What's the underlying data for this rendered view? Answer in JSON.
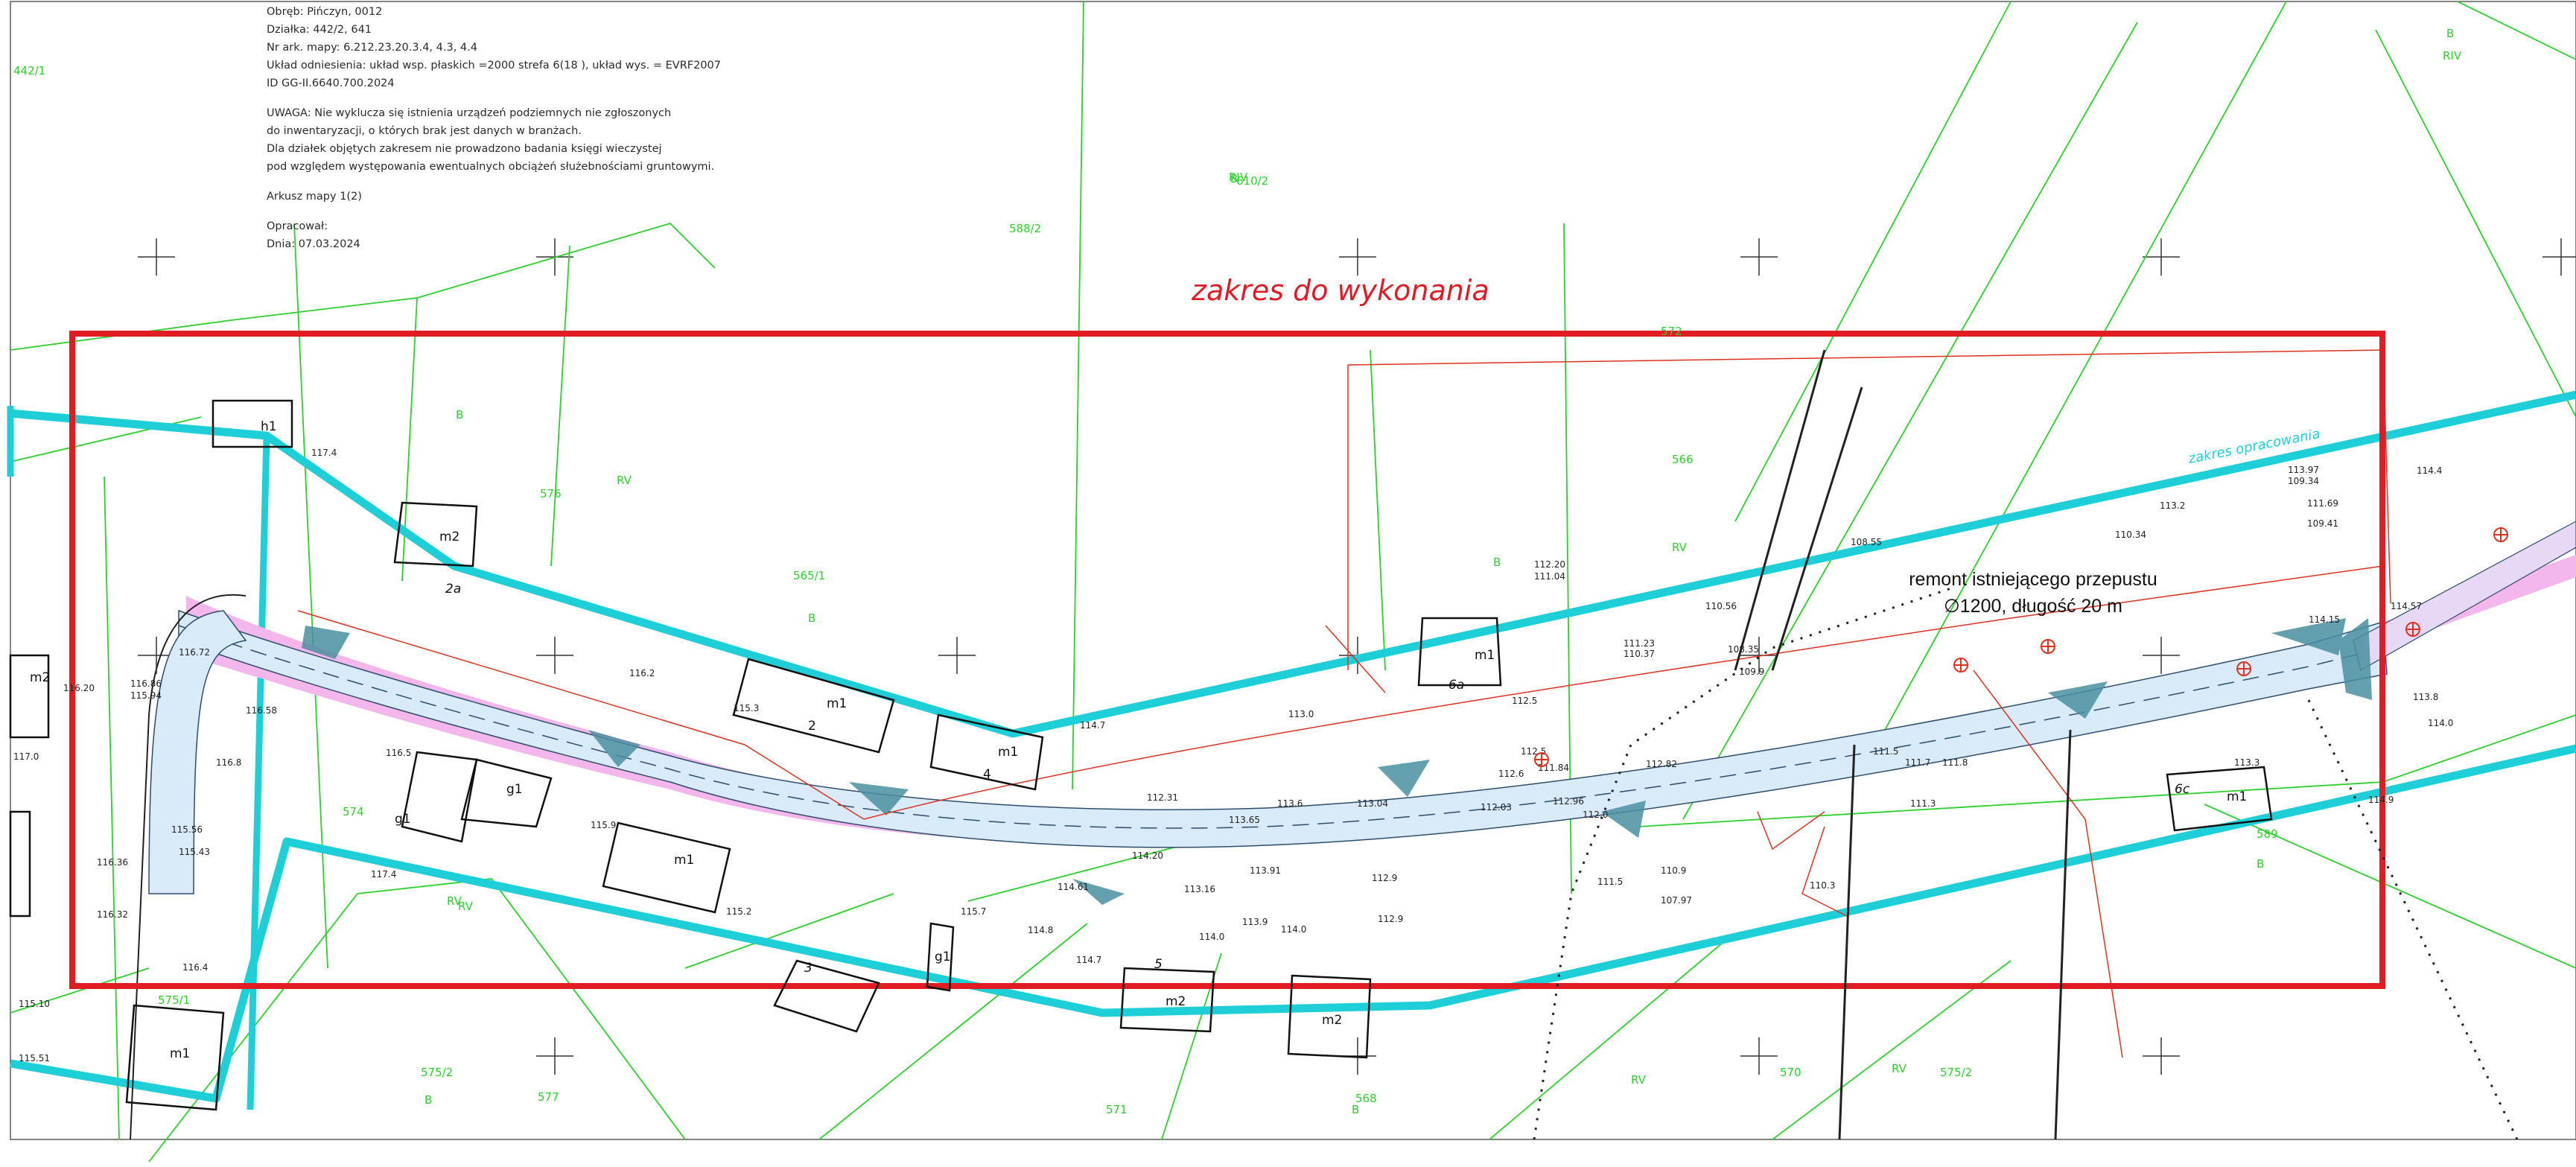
{
  "header": {
    "lines": [
      "Obręb: Pińczyn, 0012",
      "Działka: 442/2, 641",
      "Nr ark. mapy: 6.212.23.20.3.4, 4.3, 4.4",
      "Układ odniesienia: układ wsp. płaskich =2000 strefa 6(18 ), układ wys. = EVRF2007",
      "ID GG-II.6640.700.2024",
      "UWAGA: Nie wyklucza się istnienia urządzeń podziemnych nie zgłoszonych",
      "do inwentaryzacji, o których brak jest danych w branżach.",
      "Dla działek objętych zakresem nie prowadzono badania księgi wieczystej",
      "pod względem występowania ewentualnych obciążeń służebnościami gruntowymi.",
      "Arkusz mapy 1(2)",
      "Opracował:",
      "Dnia: 07.03.2024"
    ]
  },
  "scope_label": "zakres do wykonania",
  "culvert_note": {
    "line1": "remont istniejącego przepustu",
    "line2": "∅1200, długość 20 m"
  },
  "labels": {
    "zakres_opracowania": "zakres opracowania",
    "parcels": [
      "442/1",
      "588/2",
      "565/1",
      "574",
      "575/2",
      "575/1",
      "576",
      "577",
      "571",
      "566",
      "568",
      "570",
      "589",
      "610/2",
      "572",
      "575/2"
    ],
    "buildings": [
      "h1",
      "m2",
      "2a",
      "m1",
      "2",
      "m1",
      "4",
      "g1",
      "g1",
      "m1",
      "m2",
      "m2",
      "g1",
      "m1",
      "6a",
      "m1",
      "6c",
      "m1",
      "3",
      "5",
      "m2"
    ],
    "elevations": [
      "117.4",
      "116.72",
      "116.2",
      "115.3",
      "114.7",
      "113.0",
      "112.5",
      "112.20",
      "111.04",
      "111.23",
      "110.37",
      "110.56",
      "108.35",
      "109.9",
      "108.55",
      "113.97",
      "109.34",
      "113.2",
      "111.69",
      "109.41",
      "110.34",
      "114.4",
      "114.57",
      "113.8",
      "114.0",
      "114.9",
      "116.8",
      "116.5",
      "115.9",
      "117.4",
      "115.2",
      "115.7",
      "114.8",
      "114.0",
      "114.7",
      "113.9",
      "114.0",
      "112.9",
      "112.0",
      "111.5",
      "111.3",
      "111.7",
      "111.8",
      "110.9",
      "107.97",
      "110.3",
      "113.3",
      "114.15",
      "112.31",
      "112.03",
      "112.6",
      "116.4",
      "116.20",
      "117.0",
      "115.94",
      "116.86",
      "116.58",
      "116.36",
      "115.56",
      "115.43",
      "116.32",
      "115.10",
      "115.51",
      "113.65",
      "113.04",
      "112.82",
      "112.96",
      "111.5",
      "112.5",
      "111.84",
      "113.6",
      "114.20",
      "114.61",
      "113.91",
      "113.16",
      "112.9"
    ],
    "class_codes": [
      "B",
      "RV",
      "RV",
      "B",
      "RIV",
      "B",
      "RV",
      "B",
      "B",
      "RIV",
      "RV",
      "B",
      "RV",
      "B",
      "B",
      "RV"
    ]
  },
  "colors": {
    "scope_rectangle": "#e11d23",
    "study_boundary": "#1fcfd8",
    "parcel_lines": "#2bd12b",
    "road_fill": "#d7e9f8",
    "road_shoulder": "#f1b3e8",
    "junction_fill": "#4a8fa0",
    "utility_lines": "#e03020"
  }
}
